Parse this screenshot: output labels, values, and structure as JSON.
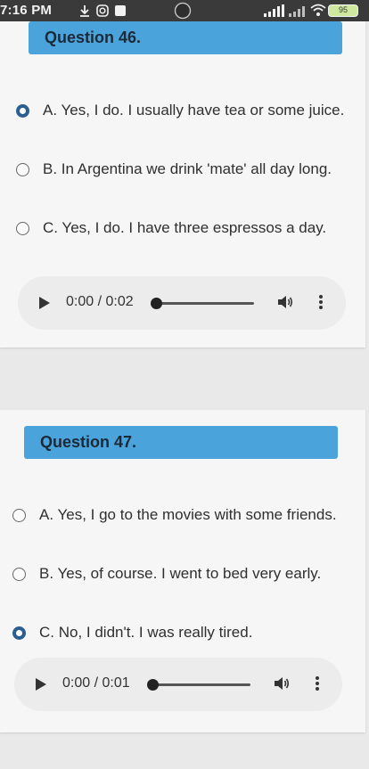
{
  "status_bar": {
    "time": "7:16 PM",
    "battery": "95",
    "icons": [
      "download-icon",
      "instagram-icon",
      "app-icon",
      "cell-signal-icon",
      "cell-signal-icon",
      "wifi-icon",
      "battery-icon"
    ]
  },
  "questions": [
    {
      "title": "Question 46.",
      "options": [
        {
          "text": "A. Yes, I do. I usually have tea or some juice.",
          "selected": true
        },
        {
          "text": "B. In Argentina we drink 'mate' all day long.",
          "selected": false
        },
        {
          "text": "C. Yes, I do. I have three espressos a day.",
          "selected": false
        }
      ],
      "audio": {
        "time": "0:00 / 0:02"
      }
    },
    {
      "title": "Question 47.",
      "options": [
        {
          "text": "A. Yes, I go to the movies with some friends.",
          "selected": false
        },
        {
          "text": "B. Yes, of course. I went to bed very early.",
          "selected": false
        },
        {
          "text": "C. No, I didn't. I was really tired.",
          "selected": true
        }
      ],
      "audio": {
        "time": "0:00 / 0:01"
      }
    }
  ],
  "colors": {
    "header_bg": "#4aa3da",
    "radio_selected": "#2a5f8f",
    "status_bar_bg": "#3a3a3a"
  }
}
